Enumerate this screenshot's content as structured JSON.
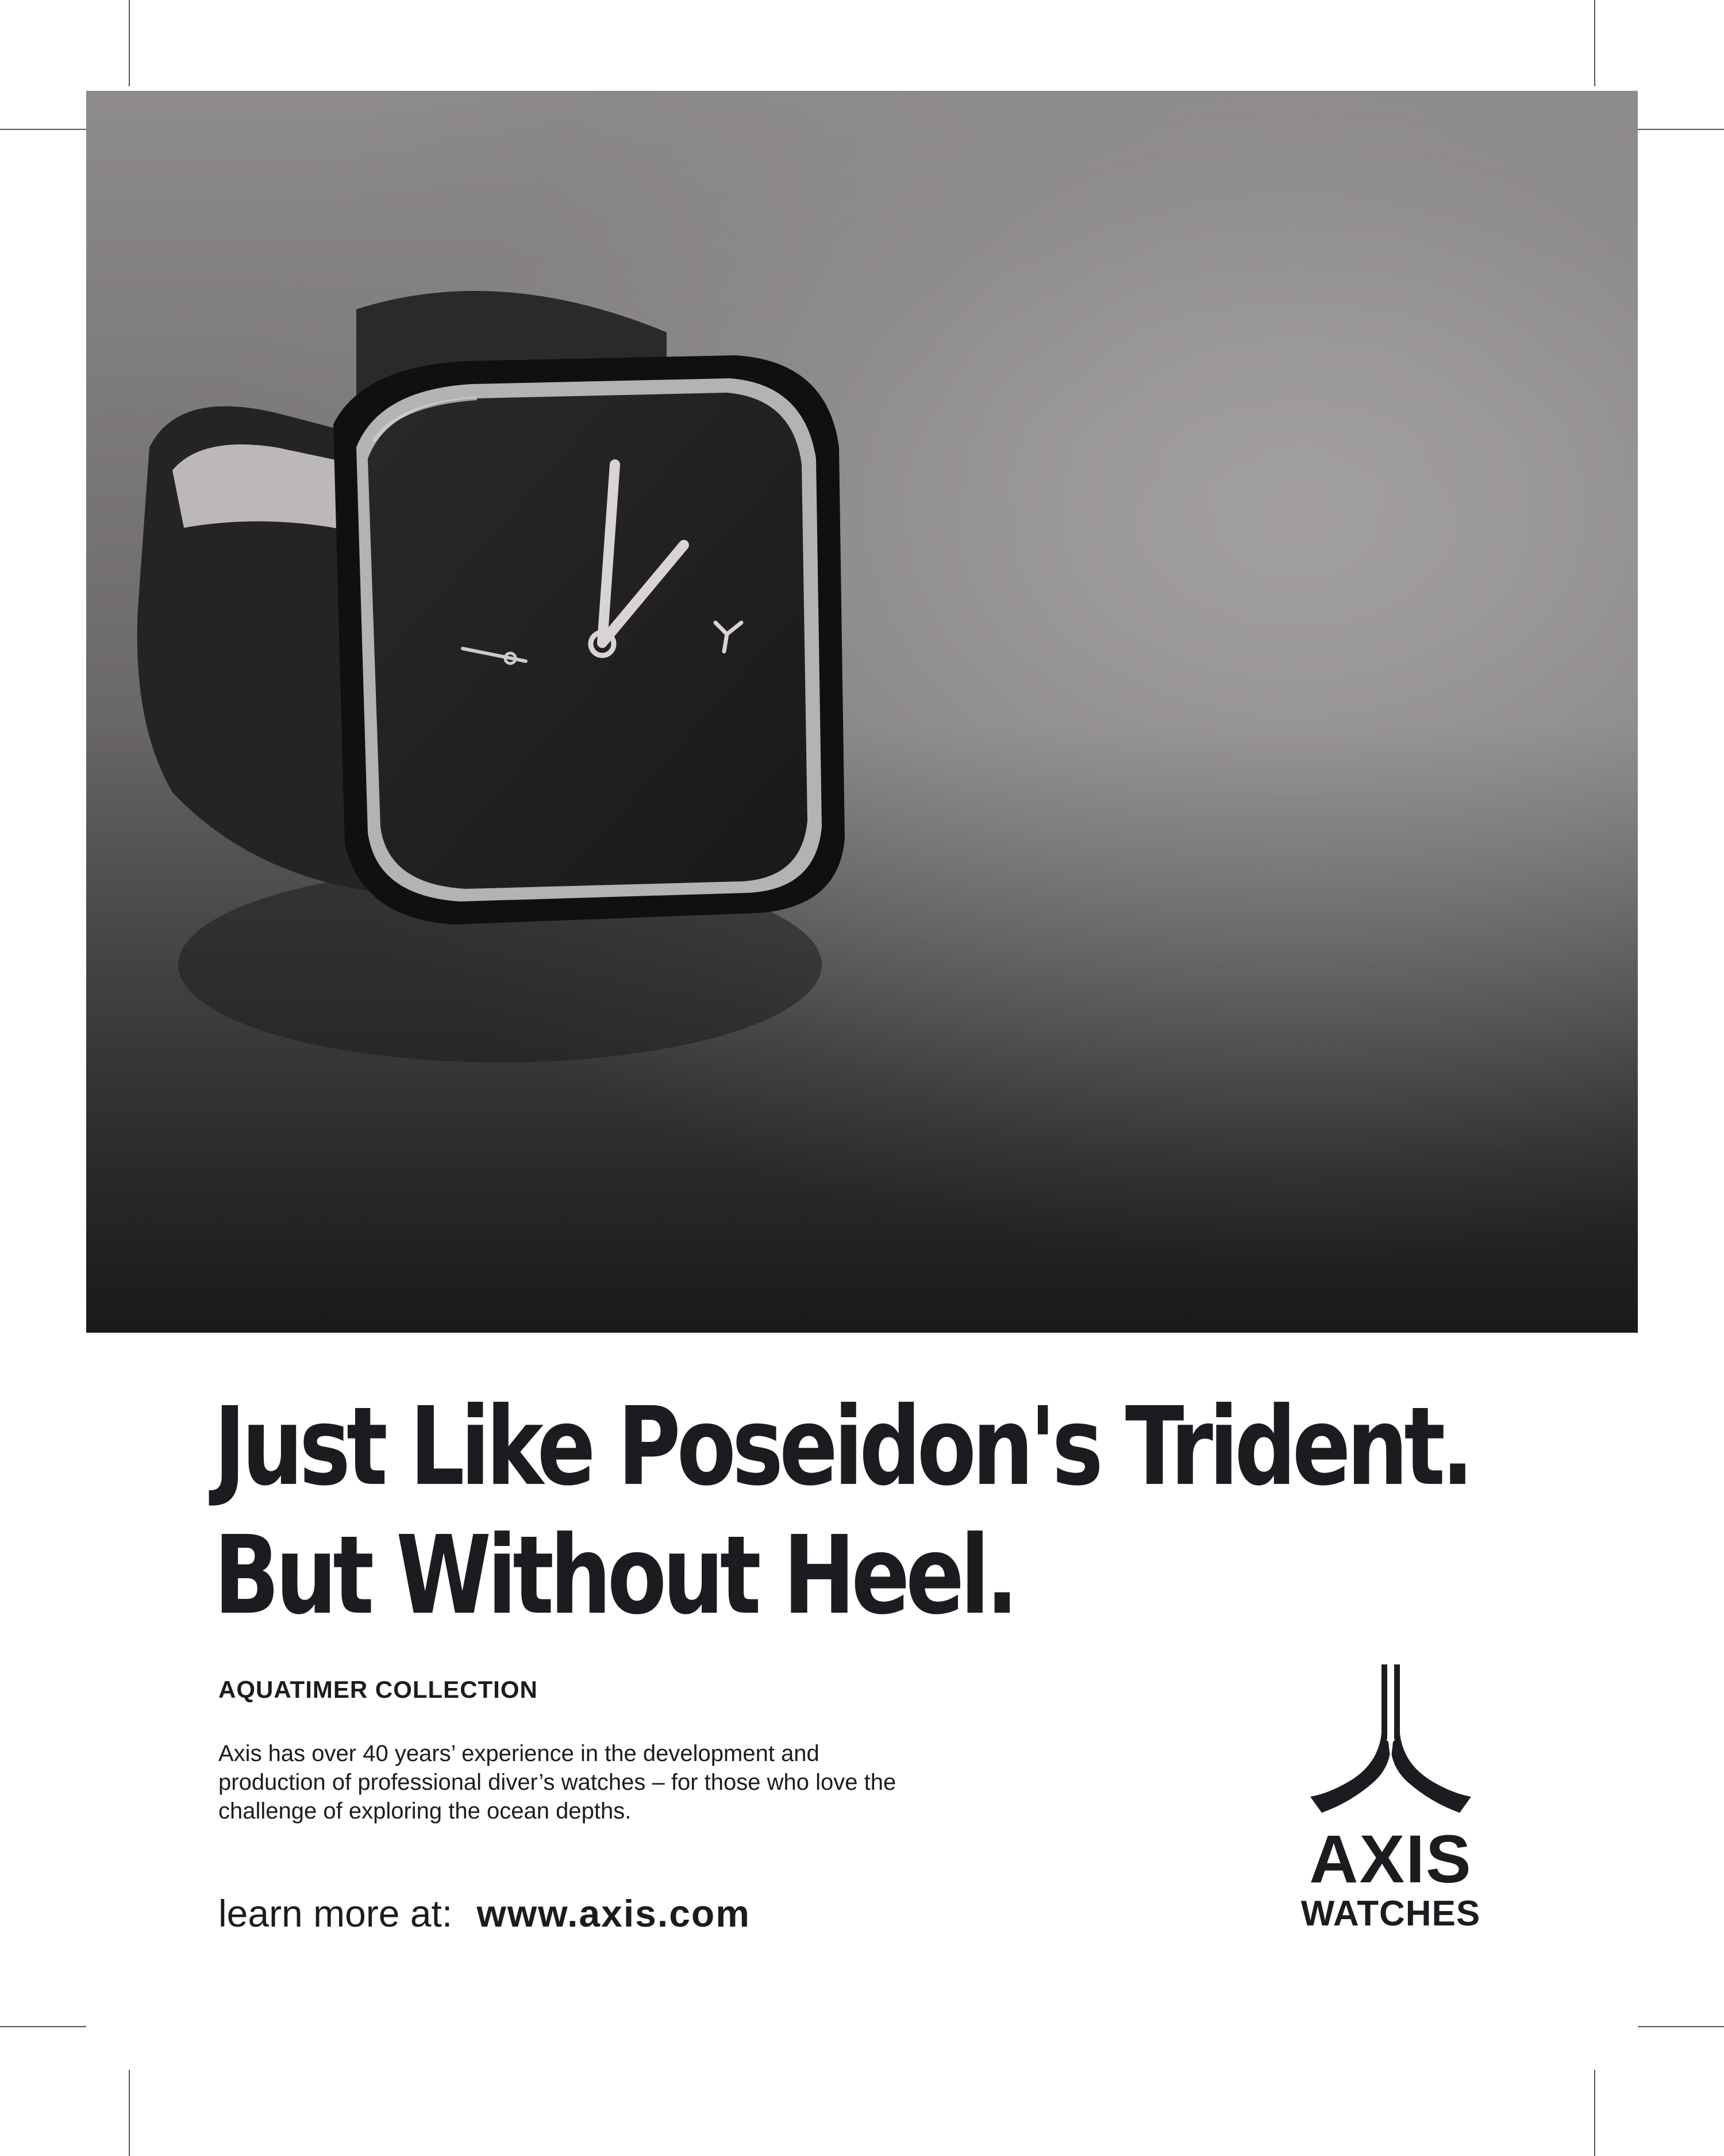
{
  "photo": {
    "subject": "watch-photo"
  },
  "headline": {
    "line1": "Just Like Poseidon's Trident.",
    "line2": "But Without Heel."
  },
  "collection": "AQUATIMER COLLECTION",
  "body": "Axis has over 40 years’ experience in the development and production of professional diver’s watches – for those who love the challenge of exploring the ocean depths.",
  "cta": {
    "prefix": "learn more at:",
    "url": "www.axis.com"
  },
  "logo": {
    "icon": "trident-icon",
    "brand": "AXIS",
    "sub": "WATCHES"
  },
  "colors": {
    "text": "#1c1b1f",
    "background": "#ffffff"
  }
}
